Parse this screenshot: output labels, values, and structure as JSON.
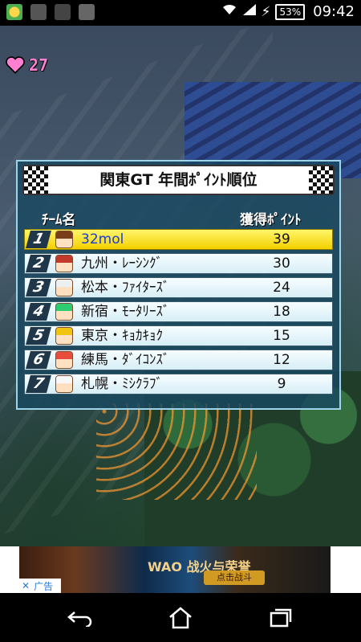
{
  "status_bar": {
    "battery": "53%",
    "time": "09:42"
  },
  "hud": {
    "hearts": "27"
  },
  "standings": {
    "title": "関東GT 年間ﾎﾟｲﾝﾄ順位",
    "team_header": "ﾁｰﾑ名",
    "points_header": "獲得ﾎﾟｲﾝﾄ",
    "rows": [
      {
        "rank": "1",
        "team": "32mol",
        "points": "39"
      },
      {
        "rank": "2",
        "team": "九州・ﾚｰｼﾝｸﾞ",
        "points": "30"
      },
      {
        "rank": "3",
        "team": "松本・ﾌｧｲﾀｰｽﾞ",
        "points": "24"
      },
      {
        "rank": "4",
        "team": "新宿・ﾓｰﾀﾘｰｽﾞ",
        "points": "18"
      },
      {
        "rank": "5",
        "team": "東京・ｷｮｶｷｮｸ",
        "points": "15"
      },
      {
        "rank": "6",
        "team": "練馬・ﾀﾞｲｺﾝｽﾞ",
        "points": "12"
      },
      {
        "rank": "7",
        "team": "札幌・ﾐｼｸﾗﾌﾞ",
        "points": "9"
      }
    ]
  },
  "ad": {
    "title": "WAO 战火与荣誉",
    "cta": "点击战斗",
    "label": "广告"
  },
  "icons": {
    "back": "back-arrow-icon",
    "home": "home-icon",
    "recent": "recent-apps-icon",
    "heart": "heart-icon"
  }
}
